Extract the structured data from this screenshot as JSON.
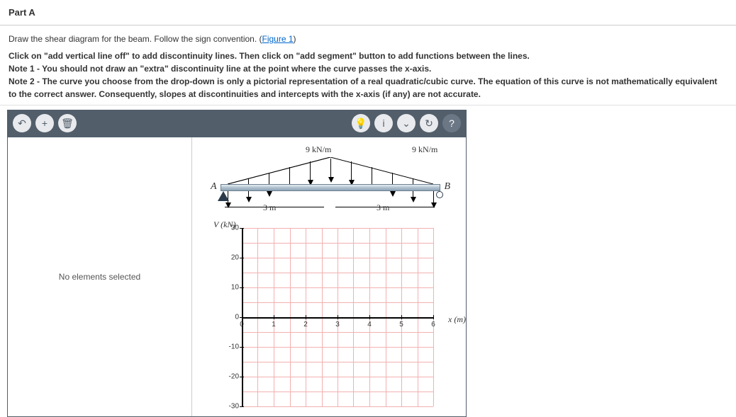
{
  "part_title": "Part A",
  "instr": {
    "line1_a": "Draw the shear diagram for the beam. Follow the sign convention. (",
    "figure_link": "Figure 1",
    "line1_b": ")",
    "line2": "Click on \"add vertical line off\" to add discontinuity lines. Then click on \"add segment\" button to add functions between the lines.",
    "note1": "Note 1 - You should not draw an \"extra\" discontinuity line at the point where the curve passes the x-axis.",
    "note2": "Note 2 - The curve you choose from the drop-down is only a pictorial representation of a real quadratic/cubic curve. The equation of this curve is not mathematically equivalent to the correct answer. Consequently, slopes at discontinuities and intercepts with the x-axis (if any) are not accurate."
  },
  "toolbar": {
    "undo": "↶",
    "add": "+",
    "trash": "🗑",
    "hint": "💡",
    "info": "i",
    "dropdown": "⌄",
    "reset": "↻",
    "help": "?"
  },
  "side_panel": {
    "empty": "No elements selected"
  },
  "beam": {
    "load_left": "9 kN/m",
    "load_right": "9 kN/m",
    "label_A": "A",
    "label_B": "B",
    "span_left": "3 m",
    "span_right": "3 m"
  },
  "chart_data": {
    "type": "line",
    "title": "",
    "ylabel": "V (kN)",
    "xlabel": "x (m)",
    "xlim": [
      0,
      6
    ],
    "ylim": [
      -30,
      30
    ],
    "x_ticks": [
      0,
      1,
      2,
      3,
      4,
      5,
      6
    ],
    "y_ticks": [
      -30,
      -20,
      -10,
      0,
      10,
      20,
      30
    ],
    "series": []
  }
}
